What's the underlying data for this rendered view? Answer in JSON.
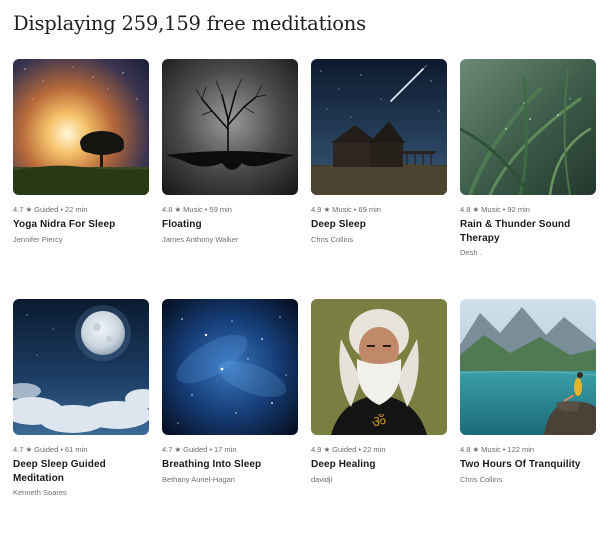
{
  "header": {
    "title": "Displaying 259,159 free meditations"
  },
  "meditations": [
    {
      "rating": "4.7",
      "type": "Guided",
      "duration": "22 min",
      "title": "Yoga Nidra For Sleep",
      "author": "Jennifer Piercy",
      "image": "sunset-tree"
    },
    {
      "rating": "4.8",
      "type": "Music",
      "duration": "59 min",
      "title": "Floating",
      "author": "James Anthony Walker",
      "image": "floating-island-tree"
    },
    {
      "rating": "4.9",
      "type": "Music",
      "duration": "69 min",
      "title": "Deep Sleep",
      "author": "Chris Collins",
      "image": "barn-night-comet"
    },
    {
      "rating": "4.8",
      "type": "Music",
      "duration": "92 min",
      "title": "Rain & Thunder Sound Therapy",
      "author": "Desh .",
      "image": "rain-grass"
    },
    {
      "rating": "4.7",
      "type": "Guided",
      "duration": "61 min",
      "title": "Deep Sleep Guided Meditation",
      "author": "Kenneth Soares",
      "image": "full-moon-clouds"
    },
    {
      "rating": "4.7",
      "type": "Guided",
      "duration": "17 min",
      "title": "Breathing Into Sleep",
      "author": "Bethany Auriel-Hagan",
      "image": "blue-nebula"
    },
    {
      "rating": "4.9",
      "type": "Guided",
      "duration": "22 min",
      "title": "Deep Healing",
      "author": "davidji",
      "image": "bearded-man-portrait"
    },
    {
      "rating": "4.8",
      "type": "Music",
      "duration": "122 min",
      "title": "Two Hours Of Tranquility",
      "author": "Chris Collins",
      "image": "mountain-lake-woman"
    }
  ]
}
